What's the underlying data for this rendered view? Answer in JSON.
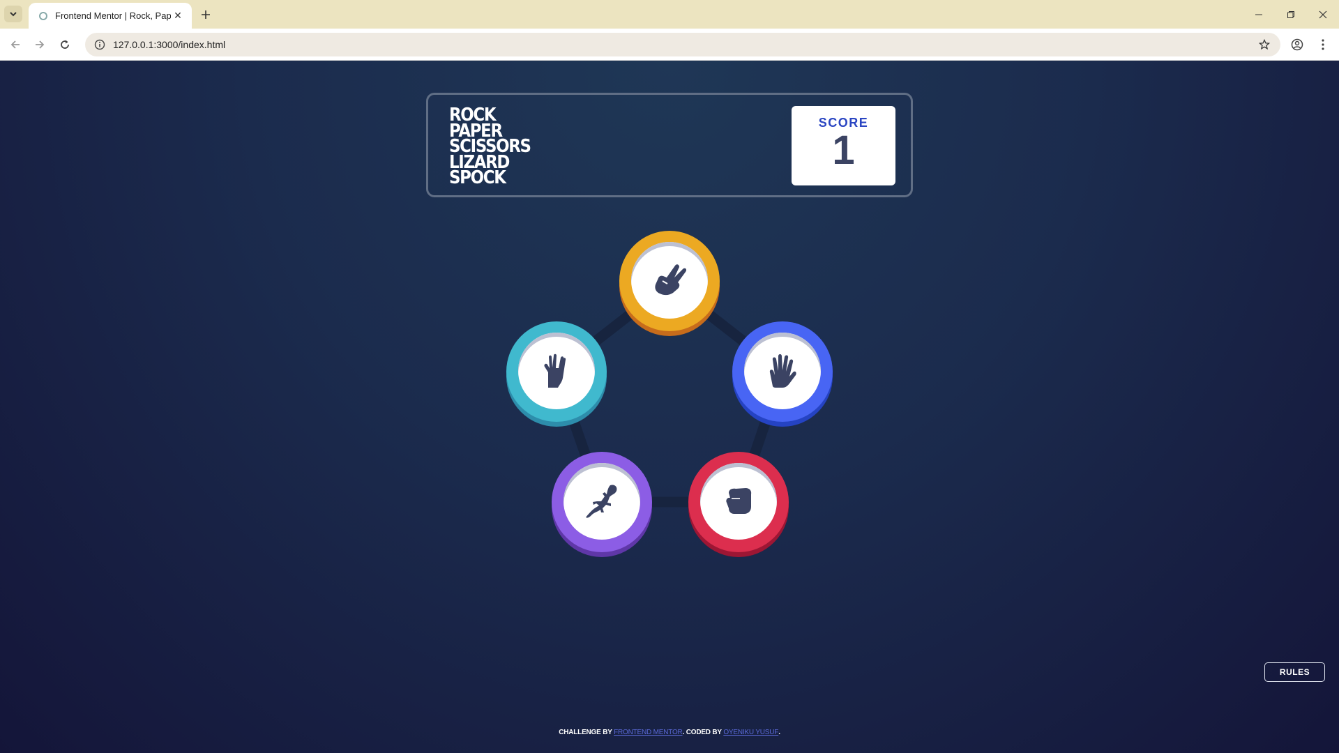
{
  "browser": {
    "tab_title": "Frontend Mentor | Rock, Paper,",
    "url": "127.0.0.1:3000/index.html"
  },
  "header": {
    "title_lines": [
      "ROCK",
      "PAPER",
      "SCISSORS",
      "LIZARD",
      "SPOCK"
    ],
    "score_label": "SCORE",
    "score_value": "1"
  },
  "tokens": [
    {
      "name": "scissors",
      "icon": "scissors-hand-icon",
      "color": "#eca922",
      "shadow": "#c76c1b"
    },
    {
      "name": "spock",
      "icon": "spock-hand-icon",
      "color": "#40b9ce",
      "shadow": "#2d8dab"
    },
    {
      "name": "paper",
      "icon": "paper-hand-icon",
      "color": "#4865f4",
      "shadow": "#2543c3"
    },
    {
      "name": "lizard",
      "icon": "lizard-icon",
      "color": "#8c5de5",
      "shadow": "#5f37a8"
    },
    {
      "name": "rock",
      "icon": "rock-fist-icon",
      "color": "#dc2e4e",
      "shadow": "#9d1634"
    }
  ],
  "rules_button": "RULES",
  "attribution": {
    "prefix": "CHALLENGE BY ",
    "link1": "FRONTEND MENTOR",
    "middle": ". CODED BY ",
    "link2": "OYENIKU YUSUF",
    "suffix": "."
  }
}
